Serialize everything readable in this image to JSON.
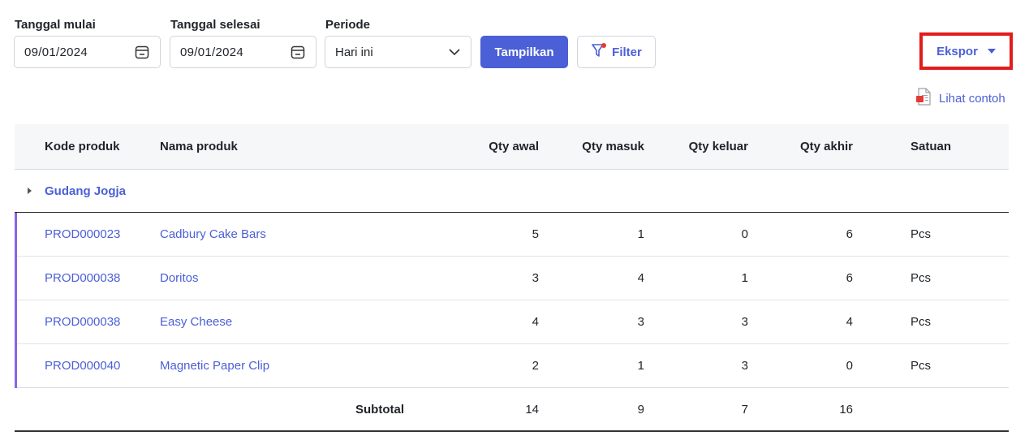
{
  "filters": {
    "start_label": "Tanggal mulai",
    "start_value": "09/01/2024",
    "end_label": "Tanggal selesai",
    "end_value": "09/01/2024",
    "period_label": "Periode",
    "period_value": "Hari ini",
    "show_button": "Tampilkan",
    "filter_button": "Filter"
  },
  "export": {
    "label": "Ekspor",
    "sample_link": "Lihat contoh"
  },
  "table": {
    "headers": {
      "code": "Kode produk",
      "name": "Nama produk",
      "qty_start": "Qty awal",
      "qty_in": "Qty masuk",
      "qty_out": "Qty keluar",
      "qty_end": "Qty akhir",
      "unit": "Satuan"
    },
    "group": "Gudang Jogja",
    "rows": [
      {
        "code": "PROD000023",
        "name": "Cadbury Cake Bars",
        "qty_start": "5",
        "qty_in": "1",
        "qty_out": "0",
        "qty_end": "6",
        "unit": "Pcs"
      },
      {
        "code": "PROD000038",
        "name": "Doritos",
        "qty_start": "3",
        "qty_in": "4",
        "qty_out": "1",
        "qty_end": "6",
        "unit": "Pcs"
      },
      {
        "code": "PROD000038",
        "name": "Easy Cheese",
        "qty_start": "4",
        "qty_in": "3",
        "qty_out": "3",
        "qty_end": "4",
        "unit": "Pcs"
      },
      {
        "code": "PROD000040",
        "name": "Magnetic Paper Clip",
        "qty_start": "2",
        "qty_in": "1",
        "qty_out": "3",
        "qty_end": "0",
        "unit": "Pcs"
      }
    ],
    "subtotal": {
      "label": "Subtotal",
      "qty_start": "14",
      "qty_in": "9",
      "qty_out": "7",
      "qty_end": "16"
    }
  },
  "colors": {
    "accent": "#4b5fd6",
    "highlight": "#e21c1c",
    "group_bar": "#8a63e6"
  }
}
